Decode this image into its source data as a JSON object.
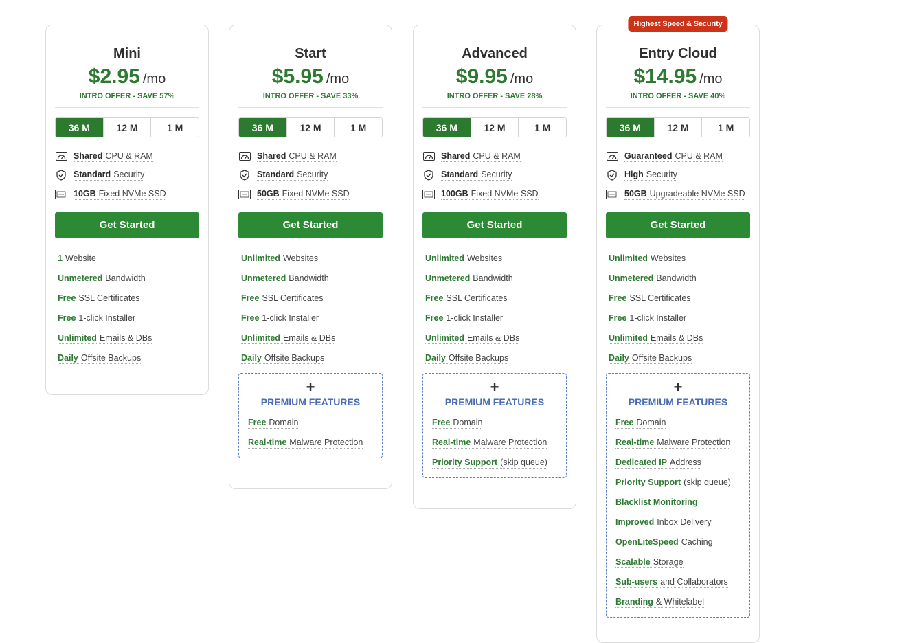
{
  "plans": [
    {
      "name": "Mini",
      "price": "$2.95",
      "per": "/mo",
      "offer": "INTRO OFFER - SAVE 57%",
      "ribbon": "",
      "terms": [
        "36 M",
        "12 M",
        "1 M"
      ],
      "specs": [
        {
          "icon": "speedometer-icon",
          "bold": "Shared",
          "text": "CPU & RAM"
        },
        {
          "icon": "shield-check-icon",
          "bold": "Standard",
          "text": "Security"
        },
        {
          "icon": "ssd-icon",
          "bold": "10GB",
          "text": "Fixed NVMe SSD"
        }
      ],
      "cta": "Get Started",
      "features": [
        {
          "bold": "1",
          "text": "Website"
        },
        {
          "bold": "Unmetered",
          "text": "Bandwidth"
        },
        {
          "bold": "Free",
          "text": "SSL Certificates"
        },
        {
          "bold": "Free",
          "text": "1-click Installer"
        },
        {
          "bold": "Unlimited",
          "text": "Emails & DBs"
        },
        {
          "bold": "Daily",
          "text": "Offsite Backups"
        }
      ],
      "premium": null
    },
    {
      "name": "Start",
      "price": "$5.95",
      "per": "/mo",
      "offer": "INTRO OFFER - SAVE 33%",
      "ribbon": "",
      "terms": [
        "36 M",
        "12 M",
        "1 M"
      ],
      "specs": [
        {
          "icon": "speedometer-icon",
          "bold": "Shared",
          "text": "CPU & RAM"
        },
        {
          "icon": "shield-check-icon",
          "bold": "Standard",
          "text": "Security"
        },
        {
          "icon": "ssd-icon",
          "bold": "50GB",
          "text": "Fixed NVMe SSD"
        }
      ],
      "cta": "Get Started",
      "features": [
        {
          "bold": "Unlimited",
          "text": "Websites"
        },
        {
          "bold": "Unmetered",
          "text": "Bandwidth"
        },
        {
          "bold": "Free",
          "text": "SSL Certificates"
        },
        {
          "bold": "Free",
          "text": "1-click Installer"
        },
        {
          "bold": "Unlimited",
          "text": "Emails & DBs"
        },
        {
          "bold": "Daily",
          "text": "Offsite Backups"
        }
      ],
      "premium": {
        "plus": "+",
        "title": "PREMIUM FEATURES",
        "items": [
          {
            "bold": "Free",
            "text": "Domain"
          },
          {
            "bold": "Real-time",
            "text": "Malware Protection"
          }
        ]
      }
    },
    {
      "name": "Advanced",
      "price": "$9.95",
      "per": "/mo",
      "offer": "INTRO OFFER - SAVE 28%",
      "ribbon": "",
      "terms": [
        "36 M",
        "12 M",
        "1 M"
      ],
      "specs": [
        {
          "icon": "speedometer-icon",
          "bold": "Shared",
          "text": "CPU & RAM"
        },
        {
          "icon": "shield-check-icon",
          "bold": "Standard",
          "text": "Security"
        },
        {
          "icon": "ssd-icon",
          "bold": "100GB",
          "text": "Fixed NVMe SSD"
        }
      ],
      "cta": "Get Started",
      "features": [
        {
          "bold": "Unlimited",
          "text": "Websites"
        },
        {
          "bold": "Unmetered",
          "text": "Bandwidth"
        },
        {
          "bold": "Free",
          "text": "SSL Certificates"
        },
        {
          "bold": "Free",
          "text": "1-click Installer"
        },
        {
          "bold": "Unlimited",
          "text": "Emails & DBs"
        },
        {
          "bold": "Daily",
          "text": "Offsite Backups"
        }
      ],
      "premium": {
        "plus": "+",
        "title": "PREMIUM FEATURES",
        "items": [
          {
            "bold": "Free",
            "text": "Domain"
          },
          {
            "bold": "Real-time",
            "text": "Malware Protection"
          },
          {
            "bold": "Priority Support",
            "text": "(skip queue)"
          }
        ]
      }
    },
    {
      "name": "Entry Cloud",
      "price": "$14.95",
      "per": "/mo",
      "offer": "INTRO OFFER - SAVE 40%",
      "ribbon": "Highest Speed & Security",
      "terms": [
        "36 M",
        "12 M",
        "1 M"
      ],
      "specs": [
        {
          "icon": "speedometer-icon",
          "bold": "Guaranteed",
          "text": "CPU & RAM"
        },
        {
          "icon": "shield-check-icon",
          "bold": "High",
          "text": "Security"
        },
        {
          "icon": "ssd-icon",
          "bold": "50GB",
          "text": "Upgradeable NVMe SSD"
        }
      ],
      "cta": "Get Started",
      "features": [
        {
          "bold": "Unlimited",
          "text": "Websites"
        },
        {
          "bold": "Unmetered",
          "text": "Bandwidth"
        },
        {
          "bold": "Free",
          "text": "SSL Certificates"
        },
        {
          "bold": "Free",
          "text": "1-click Installer"
        },
        {
          "bold": "Unlimited",
          "text": "Emails & DBs"
        },
        {
          "bold": "Daily",
          "text": "Offsite Backups"
        }
      ],
      "premium": {
        "plus": "+",
        "title": "PREMIUM FEATURES",
        "items": [
          {
            "bold": "Free",
            "text": "Domain"
          },
          {
            "bold": "Real-time",
            "text": "Malware Protection"
          },
          {
            "bold": "Dedicated IP",
            "text": "Address"
          },
          {
            "bold": "Priority Support",
            "text": "(skip queue)"
          },
          {
            "bold": "Blacklist Monitoring",
            "text": ""
          },
          {
            "bold": "Improved",
            "text": "Inbox Delivery"
          },
          {
            "bold": "OpenLiteSpeed",
            "text": "Caching"
          },
          {
            "bold": "Scalable",
            "text": "Storage"
          },
          {
            "bold": "Sub-users",
            "text": "and Collaborators"
          },
          {
            "bold": "Branding",
            "text": "& Whitelabel"
          }
        ]
      }
    }
  ],
  "active_term": "36 M",
  "colors": {
    "accent": "#2b8a33",
    "price": "#2e7a33",
    "ribbon": "#cc3319",
    "premium": "#4a6cb3"
  }
}
